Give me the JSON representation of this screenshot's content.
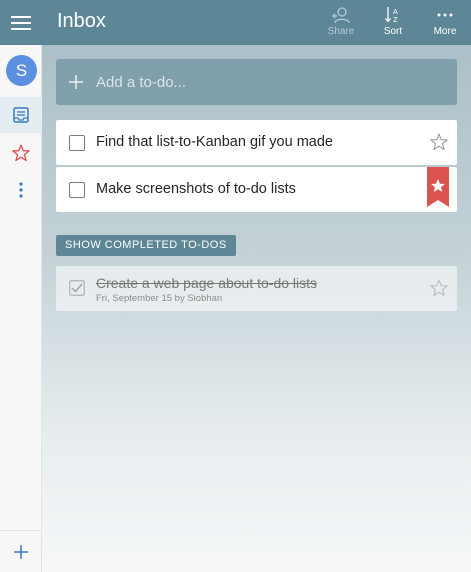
{
  "sidebar": {
    "avatar_initial": "S"
  },
  "header": {
    "title": "Inbox",
    "share_label": "Share",
    "sort_label": "Sort",
    "more_label": "More"
  },
  "add_todo": {
    "placeholder": "Add a to-do..."
  },
  "todos": [
    {
      "text": "Find that list-to-Kanban gif you made",
      "starred": false
    },
    {
      "text": "Make screenshots of to-do lists",
      "starred": true
    }
  ],
  "show_completed_label": "SHOW COMPLETED TO-DOS",
  "completed": [
    {
      "text": "Create a web page about to-do lists",
      "meta": "Fri, September 15 by Siobhan"
    }
  ],
  "colors": {
    "header": "#5d8696",
    "add_bar": "#7e9fab",
    "ribbon": "#d9534f",
    "avatar": "#5b8fe0"
  }
}
